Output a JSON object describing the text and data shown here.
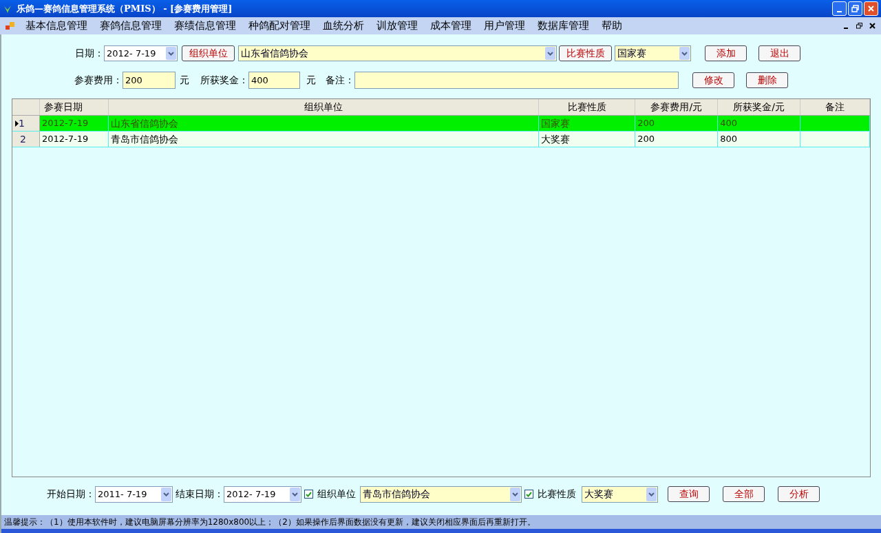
{
  "window": {
    "title": "乐鸽—赛鸽信息管理系统（PMIS） - [参赛费用管理]"
  },
  "menu": [
    "基本信息管理",
    "赛鸽信息管理",
    "赛绩信息管理",
    "种鸽配对管理",
    "血统分析",
    "训放管理",
    "成本管理",
    "用户管理",
    "数据库管理",
    "帮助"
  ],
  "form": {
    "date_label": "日期：",
    "date_value": "2012- 7-19",
    "org_button": "组织单位",
    "org_value": "山东省信鸽协会",
    "type_button": "比赛性质",
    "type_value": "国家赛",
    "fee_label": "参赛费用：",
    "fee_value": "200",
    "fee_unit": "元",
    "prize_label": "所获奖金：",
    "prize_value": "400",
    "prize_unit": "元",
    "remark_label": "备注：",
    "buttons": [
      {
        "label": "添加"
      },
      {
        "label": "退出"
      },
      {
        "label": "修改"
      },
      {
        "label": "删除"
      }
    ]
  },
  "table": {
    "columns": [
      "参赛日期",
      "组织单位",
      "比赛性质",
      "参赛费用/元",
      "所获奖金/元",
      "备注"
    ],
    "rows": [
      {
        "number": "1",
        "selected": true,
        "cells": [
          "2012-7-19",
          "山东省信鸽协会",
          "国家赛",
          "200",
          "400"
        ]
      },
      {
        "number": "2",
        "selected": false,
        "cells": [
          "2012-7-19",
          "青岛市信鸽协会",
          "大奖赛",
          "200",
          "800"
        ]
      }
    ]
  },
  "filter": {
    "start_label": "开始日期：",
    "start_value": "2011- 7-19",
    "end_label": "结束日期：",
    "end_value": "2012- 7-19",
    "org_checked": true,
    "org_label": "组织单位",
    "org_value": "青岛市信鸽协会",
    "type_checked": true,
    "type_label": "比赛性质",
    "type_value": "大奖赛",
    "buttons": [
      {
        "label": "查询"
      },
      {
        "label": "全部"
      },
      {
        "label": "分析"
      }
    ]
  },
  "status_bar": "温馨提示：（1）使用本软件时，建议电脑屏幕分辨率为1280x800以上；（2）如果操作后界面数据没有更新，建议关闭相应界面后再重新打开。"
}
